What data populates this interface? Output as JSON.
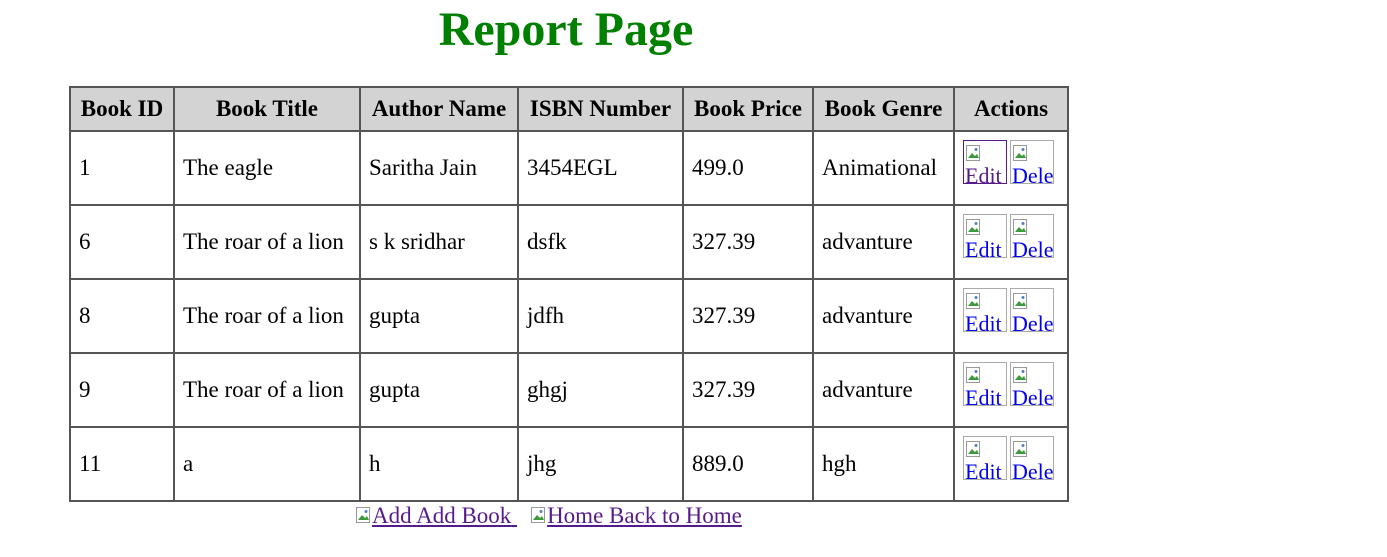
{
  "page": {
    "title": "Report Page"
  },
  "table": {
    "headers": [
      "Book ID",
      "Book Title",
      "Author Name",
      "ISBN Number",
      "Book Price",
      "Book Genre",
      "Actions"
    ],
    "rows": [
      {
        "id": "1",
        "title": "The eagle",
        "author": "Saritha Jain",
        "isbn": "3454EGL",
        "price": "499.0",
        "genre": "Animational",
        "edit_alt": "Edit",
        "delete_alt": "Delete"
      },
      {
        "id": "6",
        "title": "The roar of a lion",
        "author": "s k sridhar",
        "isbn": "dsfk",
        "price": "327.39",
        "genre": "advanture",
        "edit_alt": "Edit",
        "delete_alt": "Delete"
      },
      {
        "id": "8",
        "title": "The roar of a lion",
        "author": "gupta",
        "isbn": "jdfh",
        "price": "327.39",
        "genre": "advanture",
        "edit_alt": "Edit",
        "delete_alt": "Delete"
      },
      {
        "id": "9",
        "title": "The roar of a lion",
        "author": "gupta",
        "isbn": "ghgj",
        "price": "327.39",
        "genre": "advanture",
        "edit_alt": "Edit",
        "delete_alt": "Delete"
      },
      {
        "id": "11",
        "title": "a",
        "author": "h",
        "isbn": "jhg",
        "price": "889.0",
        "genre": "hgh",
        "edit_alt": "Edit",
        "delete_alt": "Delete"
      }
    ]
  },
  "footer": {
    "add_alt": "Add",
    "add_label": "Add Book",
    "home_alt": "Home",
    "home_label": "Back to Home"
  },
  "colors": {
    "title": "#008000",
    "header_bg": "#d3d3d3",
    "link": "#0000ee",
    "visited_link": "#551a8b"
  },
  "icons": {
    "broken_image": "broken-image-icon"
  }
}
